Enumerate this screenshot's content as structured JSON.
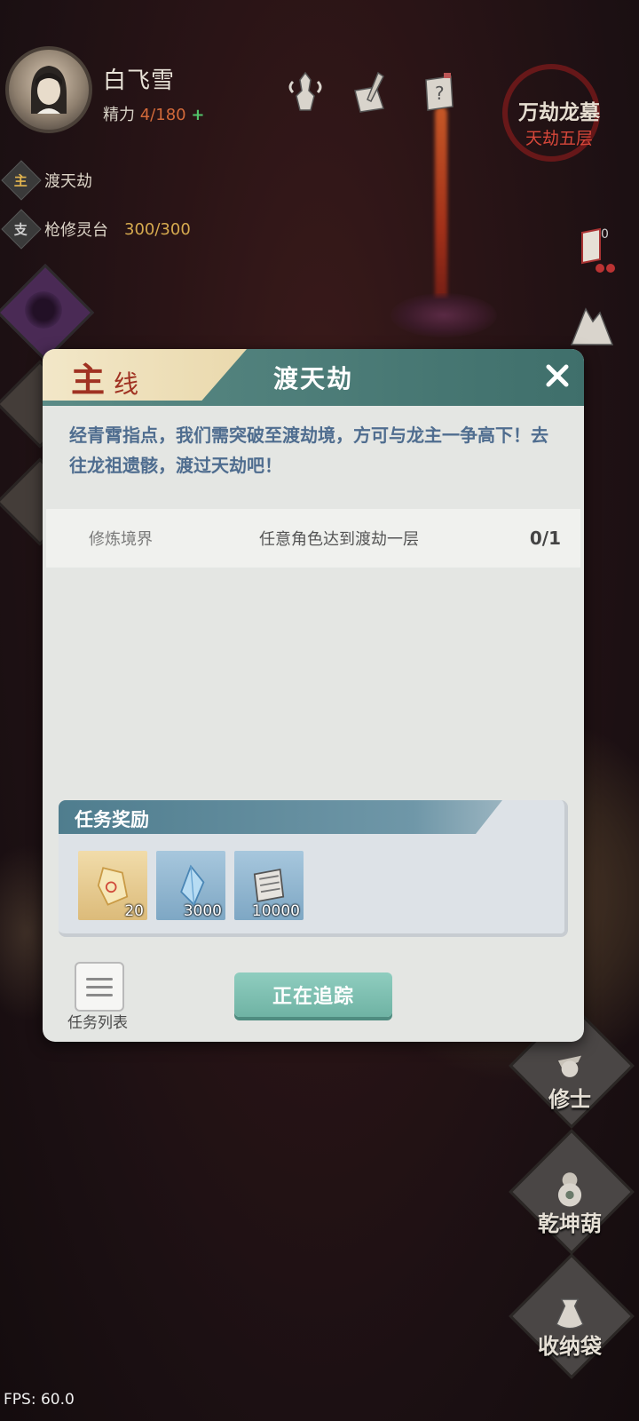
{
  "player": {
    "name": "白飞雪",
    "energy_label": "精力",
    "energy_value": "4/180",
    "energy_plus": "+"
  },
  "location": {
    "name": "万劫龙墓",
    "floor": "天劫五层"
  },
  "quests": {
    "main_badge": "主",
    "main_title": "渡天劫",
    "side_badge": "支",
    "side_title": "枪修灵台",
    "side_progress": "300/300"
  },
  "right_top": {
    "badge_count": "0"
  },
  "right_menu": [
    {
      "label": "修士",
      "icon": "cultivator-icon"
    },
    {
      "label": "乾坤葫",
      "icon": "gourd-icon"
    },
    {
      "label": "收纳袋",
      "icon": "bag-icon"
    }
  ],
  "fps": "FPS: 60.0",
  "dialog": {
    "tag_main": "主",
    "tag_sub": "线",
    "title": "渡天劫",
    "description": "经青霄指点，我们需突破至渡劫境，方可与龙主一争高下！去往龙祖遗骸，渡过天劫吧！",
    "requirement": {
      "type": "修炼境界",
      "desc": "任意角色达到渡劫一层",
      "progress": "0/1"
    },
    "rewards_title": "任务奖励",
    "rewards": [
      {
        "icon": "crystal-shard-icon",
        "qty": "20",
        "bg": "#e8c98a"
      },
      {
        "icon": "blue-crystal-icon",
        "qty": "3000",
        "bg": "#8fb6d2"
      },
      {
        "icon": "scroll-book-icon",
        "qty": "10000",
        "bg": "#8fb6d2"
      }
    ],
    "task_list_label": "任务列表",
    "track_button": "正在追踪"
  },
  "colors": {
    "accent_teal": "#5b8b86",
    "energy_red": "#d36a3a",
    "floor_red": "#d7473a",
    "progress_gold": "#d6aa4f"
  }
}
